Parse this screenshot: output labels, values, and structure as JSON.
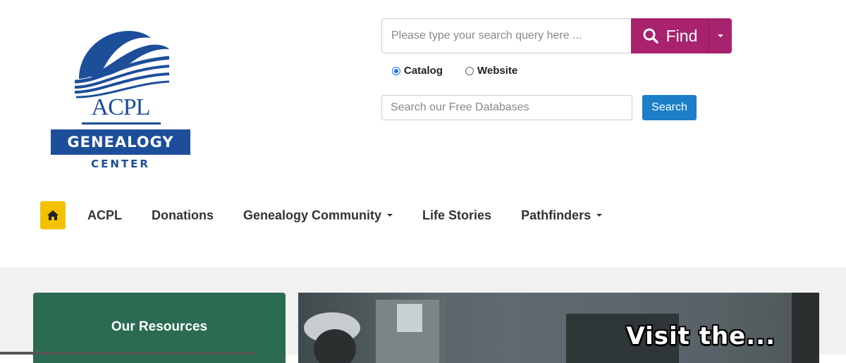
{
  "logo": {
    "name": "ACPL",
    "banner": "GENEALOGY",
    "sub": "CENTER",
    "colors": {
      "brand_blue": "#1d4e9a"
    }
  },
  "search": {
    "placeholder": "Please type your search query here ...",
    "value": "",
    "button_label": "Find",
    "button_color": "#a8226d",
    "scope_options": [
      {
        "label": "Catalog",
        "selected": true
      },
      {
        "label": "Website",
        "selected": false
      }
    ]
  },
  "databases": {
    "placeholder": "Search our Free Databases",
    "value": "",
    "button_label": "Search",
    "button_color": "#1c7ec7"
  },
  "nav": {
    "home_icon": "home-icon",
    "home_color": "#f2c200",
    "items": [
      {
        "label": "ACPL",
        "dropdown": false
      },
      {
        "label": "Donations",
        "dropdown": false
      },
      {
        "label": "Genealogy Community",
        "dropdown": true
      },
      {
        "label": "Life Stories",
        "dropdown": false
      },
      {
        "label": "Pathfinders",
        "dropdown": true
      }
    ]
  },
  "resources": {
    "title": "Our Resources",
    "color": "#2a6b52"
  },
  "banner": {
    "caption": "Visit the..."
  }
}
